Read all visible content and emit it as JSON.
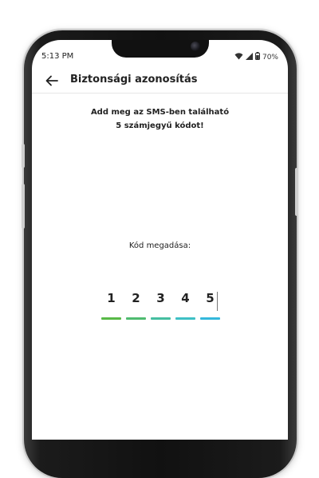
{
  "status_bar": {
    "time": "5:13 PM",
    "battery": "70%",
    "wifi_icon": "wifi-icon",
    "signal_icon": "signal-icon",
    "battery_icon": "battery-icon"
  },
  "header": {
    "back_icon": "arrow-left-icon",
    "title": "Biztonsági azonosítás"
  },
  "instruction": {
    "line1": "Add meg az SMS-ben található",
    "line2": "5 számjegyű kódot!"
  },
  "code": {
    "label": "Kód megadása:",
    "digits": [
      "1",
      "2",
      "3",
      "4",
      "5"
    ],
    "underline_colors": [
      "#58b947",
      "#4fbb70",
      "#45bea0",
      "#3ec0c5",
      "#34b8dc"
    ]
  }
}
